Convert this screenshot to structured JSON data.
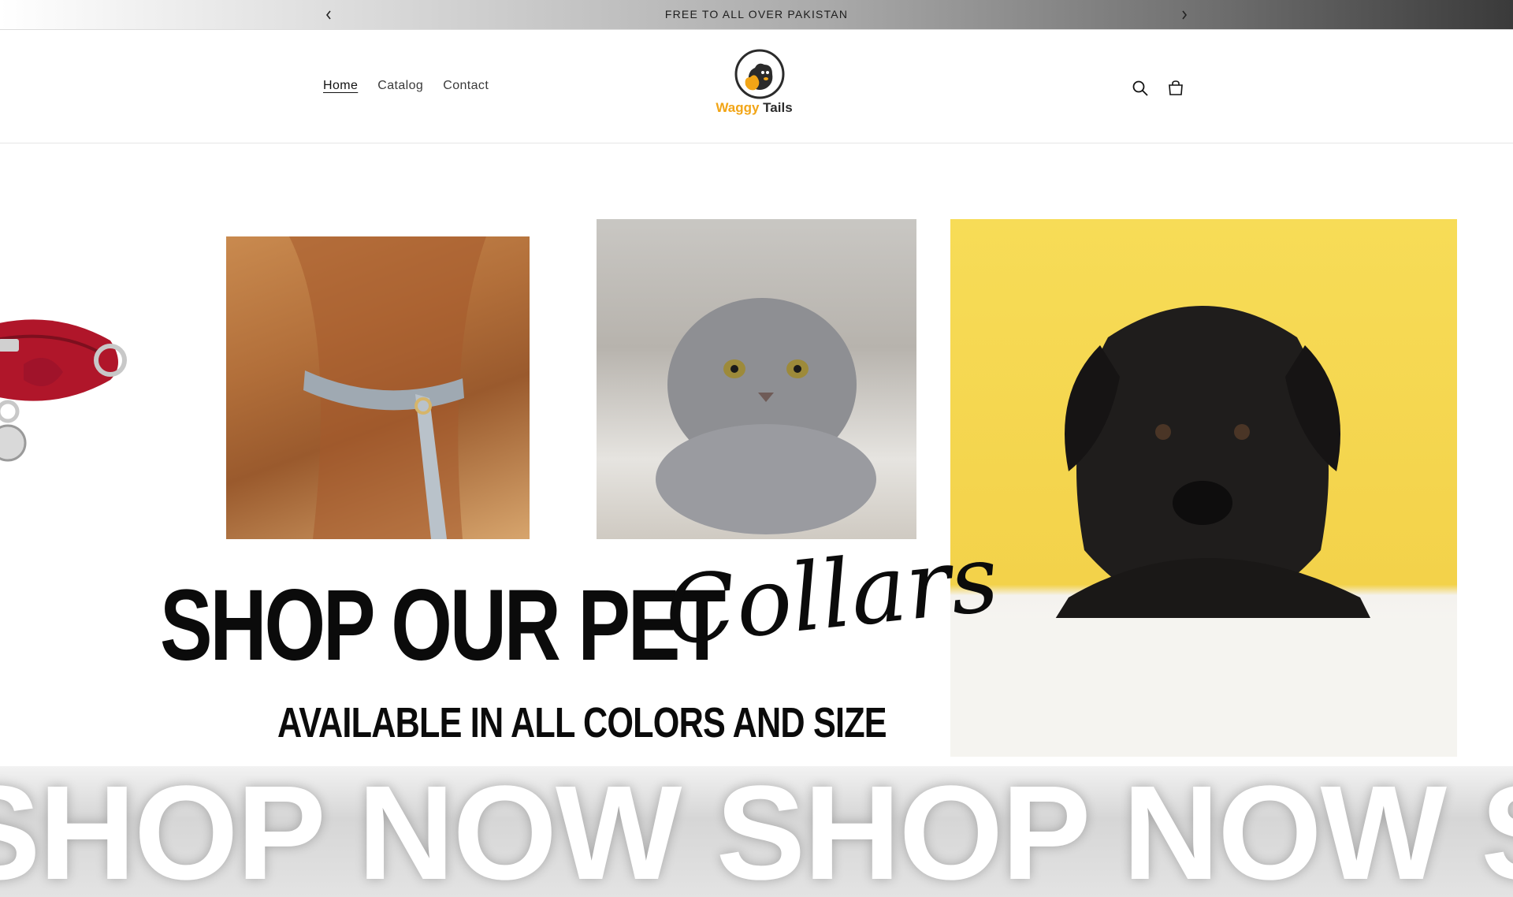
{
  "announcement": {
    "message": "FREE TO ALL OVER PAKISTAN",
    "prev_icon": "chevron-left-icon",
    "next_icon": "chevron-right-icon"
  },
  "header": {
    "nav": [
      {
        "label": "Home",
        "active": true
      },
      {
        "label": "Catalog",
        "active": false
      },
      {
        "label": "Contact",
        "active": false
      }
    ],
    "logo": {
      "word1": "Waggy",
      "word2": "Tails"
    },
    "icons": {
      "search": "search-icon",
      "cart": "cart-icon"
    }
  },
  "hero": {
    "title": "SHOP OUR PET",
    "script": "Collars",
    "subtitle": "AVAILABLE IN ALL COLORS AND SIZE",
    "marquee": "SHOP NOW SHOP NOW SHOP NOW SHOP NOW"
  },
  "colors": {
    "brand_orange": "#f2a516",
    "text_dark": "#121212",
    "puppy_bg": "#f3d24a"
  }
}
